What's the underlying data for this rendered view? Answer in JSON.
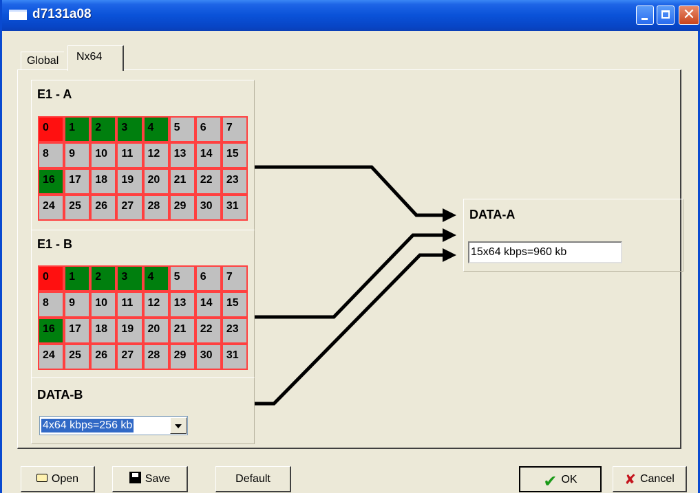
{
  "window": {
    "title": "d7131a08"
  },
  "tabs": [
    {
      "label": "Global"
    },
    {
      "label": "Nx64"
    }
  ],
  "e1a": {
    "title": "E1 - A",
    "slots": [
      {
        "label": "0",
        "state": "red"
      },
      {
        "label": "1",
        "state": "green"
      },
      {
        "label": "2",
        "state": "green"
      },
      {
        "label": "3",
        "state": "green"
      },
      {
        "label": "4",
        "state": "green"
      },
      {
        "label": "5",
        "state": "gray"
      },
      {
        "label": "6",
        "state": "gray"
      },
      {
        "label": "7",
        "state": "gray"
      },
      {
        "label": "8",
        "state": "gray"
      },
      {
        "label": "9",
        "state": "gray"
      },
      {
        "label": "10",
        "state": "gray"
      },
      {
        "label": "11",
        "state": "gray"
      },
      {
        "label": "12",
        "state": "gray"
      },
      {
        "label": "13",
        "state": "gray"
      },
      {
        "label": "14",
        "state": "gray"
      },
      {
        "label": "15",
        "state": "gray"
      },
      {
        "label": "16",
        "state": "green"
      },
      {
        "label": "17",
        "state": "gray"
      },
      {
        "label": "18",
        "state": "gray"
      },
      {
        "label": "19",
        "state": "gray"
      },
      {
        "label": "20",
        "state": "gray"
      },
      {
        "label": "21",
        "state": "gray"
      },
      {
        "label": "22",
        "state": "gray"
      },
      {
        "label": "23",
        "state": "gray"
      },
      {
        "label": "24",
        "state": "gray"
      },
      {
        "label": "25",
        "state": "gray"
      },
      {
        "label": "26",
        "state": "gray"
      },
      {
        "label": "27",
        "state": "gray"
      },
      {
        "label": "28",
        "state": "gray"
      },
      {
        "label": "29",
        "state": "gray"
      },
      {
        "label": "30",
        "state": "gray"
      },
      {
        "label": "31",
        "state": "gray"
      }
    ]
  },
  "e1b": {
    "title": "E1 - B",
    "slots": [
      {
        "label": "0",
        "state": "red"
      },
      {
        "label": "1",
        "state": "green"
      },
      {
        "label": "2",
        "state": "green"
      },
      {
        "label": "3",
        "state": "green"
      },
      {
        "label": "4",
        "state": "green"
      },
      {
        "label": "5",
        "state": "gray"
      },
      {
        "label": "6",
        "state": "gray"
      },
      {
        "label": "7",
        "state": "gray"
      },
      {
        "label": "8",
        "state": "gray"
      },
      {
        "label": "9",
        "state": "gray"
      },
      {
        "label": "10",
        "state": "gray"
      },
      {
        "label": "11",
        "state": "gray"
      },
      {
        "label": "12",
        "state": "gray"
      },
      {
        "label": "13",
        "state": "gray"
      },
      {
        "label": "14",
        "state": "gray"
      },
      {
        "label": "15",
        "state": "gray"
      },
      {
        "label": "16",
        "state": "green"
      },
      {
        "label": "17",
        "state": "gray"
      },
      {
        "label": "18",
        "state": "gray"
      },
      {
        "label": "19",
        "state": "gray"
      },
      {
        "label": "20",
        "state": "gray"
      },
      {
        "label": "21",
        "state": "gray"
      },
      {
        "label": "22",
        "state": "gray"
      },
      {
        "label": "23",
        "state": "gray"
      },
      {
        "label": "24",
        "state": "gray"
      },
      {
        "label": "25",
        "state": "gray"
      },
      {
        "label": "26",
        "state": "gray"
      },
      {
        "label": "27",
        "state": "gray"
      },
      {
        "label": "28",
        "state": "gray"
      },
      {
        "label": "29",
        "state": "gray"
      },
      {
        "label": "30",
        "state": "gray"
      },
      {
        "label": "31",
        "state": "gray"
      }
    ]
  },
  "data_b": {
    "title": "DATA-B",
    "selected": "4x64 kbps=256 kb"
  },
  "data_a": {
    "title": "DATA-A",
    "value": "15x64 kbps=960 kb"
  },
  "buttons": {
    "open": "Open",
    "save": "Save",
    "default": "Default",
    "ok": "OK",
    "cancel": "Cancel"
  },
  "colors": {
    "slot_green": "#007f0e",
    "slot_red": "#ff1010",
    "slot_gray": "#c0c0c0",
    "slot_border": "#ff4040",
    "titlebar": "#0a52d8"
  },
  "icons": {
    "open": "folder-icon",
    "save": "floppy-disk-icon",
    "ok": "checkmark-icon",
    "cancel": "x-icon"
  }
}
